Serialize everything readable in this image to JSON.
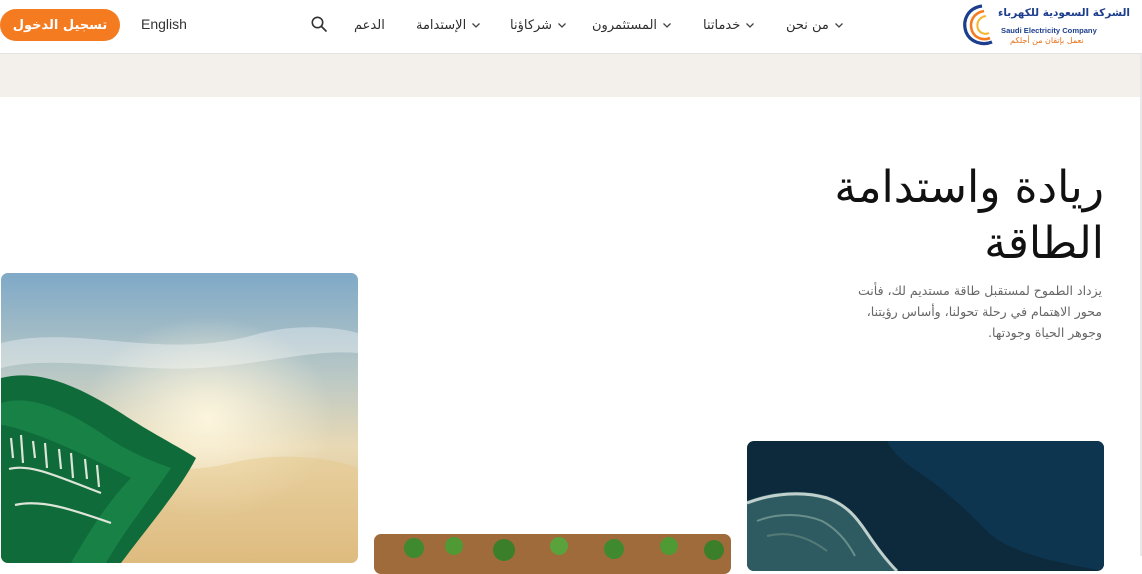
{
  "header": {
    "logo": {
      "name_ar": "الشركة السعودية للكهرباء",
      "name_en": "Saudi Electricity Company",
      "tagline": "نعمل بإتقان من أجلكم"
    },
    "nav": [
      {
        "label": "من نحن",
        "has_dropdown": true
      },
      {
        "label": "خدماتنا",
        "has_dropdown": true
      },
      {
        "label": "المستثمرون",
        "has_dropdown": true
      },
      {
        "label": "شركاؤنا",
        "has_dropdown": true
      },
      {
        "label": "الإستدامة",
        "has_dropdown": true
      },
      {
        "label": "الدعم",
        "has_dropdown": false
      }
    ],
    "search_icon": "search-icon",
    "language_link": "English",
    "login_label": "تسجيل الدخول"
  },
  "hero": {
    "title": "ريادة واستدامة الطاقة",
    "description": "يزداد الطموح لمستقبل طاقة مستديم لك، فأنت محور الاهتمام في رحلة تحولنا، وأساس رؤيتنا، وجوهر الحياة وجودتها."
  },
  "colors": {
    "accent": "#f47b20",
    "brand_blue": "#1d3e8c",
    "strip_bg": "#f3f0ec"
  }
}
